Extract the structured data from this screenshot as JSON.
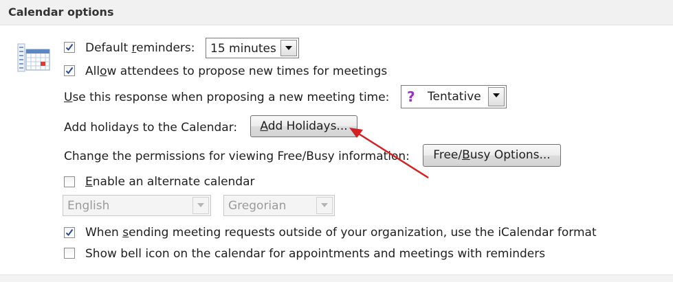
{
  "section": {
    "title": "Calendar options"
  },
  "options": {
    "default_reminders": {
      "checked": true,
      "label_pre": "Default ",
      "label_accel": "r",
      "label_post": "eminders:",
      "value": "15 minutes"
    },
    "allow_propose": {
      "checked": true,
      "label_pre": "All",
      "label_accel": "o",
      "label_post": "w attendees to propose new times for meetings"
    },
    "response": {
      "label_accel": "U",
      "label_post": "se this response when proposing a new meeting time:",
      "value": "Tentative",
      "icon": "question-icon",
      "icon_color": "#9b30c8"
    },
    "holidays": {
      "label": "Add holidays to the Calendar:",
      "button_pre": "",
      "button_accel": "A",
      "button_post": "dd Holidays..."
    },
    "freebusy": {
      "label": "Change the permissions for viewing Free/Busy information:",
      "button_pre": "Free/",
      "button_accel": "B",
      "button_post": "usy Options..."
    },
    "alt_calendar": {
      "checked": false,
      "label_pre": "",
      "label_accel": "E",
      "label_post": "nable an alternate calendar",
      "language": "English",
      "calendar_type": "Gregorian"
    },
    "icalendar": {
      "checked": true,
      "label_pre": "When ",
      "label_accel": "s",
      "label_post": "ending meeting requests outside of your organization, use the iCalendar format"
    },
    "bell_icon": {
      "checked": false,
      "label": "Show bell icon on the calendar for appointments and meetings with reminders"
    }
  },
  "annotation": {
    "arrow_color": "#d42020"
  },
  "colors": {
    "check": "#2a4a88",
    "header_bg": "#f1f1f1"
  }
}
